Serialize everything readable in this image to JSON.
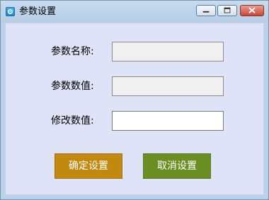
{
  "window": {
    "title": "参数设置",
    "controls": {
      "minimize": "minimize-icon",
      "maximize": "maximize-icon",
      "close": "close-icon"
    }
  },
  "form": {
    "param_name_label": "参数名称:",
    "param_value_label": "参数数值:",
    "edit_value_label": "修改数值:",
    "param_name_value": "",
    "param_value_value": "",
    "edit_value_value": ""
  },
  "buttons": {
    "confirm_label": "确定设置",
    "cancel_label": "取消设置"
  },
  "colors": {
    "confirm_button": "#c2880f",
    "cancel_button": "#6b8e23",
    "client_background": "#dfe3f7"
  }
}
